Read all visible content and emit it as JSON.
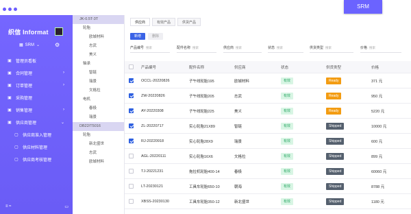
{
  "window": {
    "srm_tab_label": "SRM"
  },
  "sidebar": {
    "brand": "织信 Informat",
    "module_select": "SRM",
    "menu": [
      {
        "icon": "dashboard-icon",
        "label": "管理员看板",
        "arrow": ""
      },
      {
        "icon": "contract-icon",
        "label": "合同管理",
        "arrow": "›"
      },
      {
        "icon": "order-icon",
        "label": "订单管理",
        "arrow": "›"
      },
      {
        "icon": "purchase-icon",
        "label": "采购管理",
        "arrow": ""
      },
      {
        "icon": "sales-icon",
        "label": "销售管理",
        "arrow": "›"
      },
      {
        "icon": "supplier-icon",
        "label": "供应商管理",
        "arrow": "⌄"
      }
    ],
    "submenu": [
      {
        "icon": "entry-icon",
        "label": "供应商准入管理"
      },
      {
        "icon": "material-icon",
        "label": "供应材料管理"
      },
      {
        "icon": "assessment-icon",
        "label": "供应商考核管理"
      }
    ],
    "bottom_left": "≡  ≈",
    "bottom_right": "▭"
  },
  "tree": [
    {
      "type": "group",
      "label": "JK-0.5T-3T"
    },
    {
      "type": "l1",
      "label": "轮胎"
    },
    {
      "type": "l2",
      "label": "欧城材料"
    },
    {
      "type": "l2",
      "label": "志武"
    },
    {
      "type": "l2",
      "label": "美义"
    },
    {
      "type": "l1",
      "label": "轴承"
    },
    {
      "type": "l2",
      "label": "智链"
    },
    {
      "type": "l2",
      "label": "瑞景"
    },
    {
      "type": "l2",
      "label": "文格拉"
    },
    {
      "type": "l1",
      "label": "电机"
    },
    {
      "type": "l2",
      "label": "春极"
    },
    {
      "type": "l2",
      "label": "瑞景"
    },
    {
      "type": "group",
      "label": "DB22/T5016"
    },
    {
      "type": "l1",
      "label": "轮胎"
    },
    {
      "type": "l2",
      "label": "新北盛世"
    },
    {
      "type": "l2",
      "label": "志武"
    },
    {
      "type": "l2",
      "label": "欧城材料"
    }
  ],
  "main": {
    "tabs": [
      "供应商",
      "有效产品",
      "供货产品"
    ],
    "btn_new": "新增",
    "btn_delete": "删除",
    "filters": [
      {
        "label": "产品编号",
        "placeholder": "搜索"
      },
      {
        "label": "配件名称",
        "placeholder": "搜索"
      },
      {
        "label": "供应商",
        "placeholder": "搜索"
      },
      {
        "label": "状态",
        "placeholder": "搜索"
      },
      {
        "label": "供货类型",
        "placeholder": "搜索"
      },
      {
        "label": "价格",
        "placeholder": "搜索"
      }
    ],
    "columns": [
      "产品编号",
      "配件名称",
      "供应商",
      "状态",
      "供货类型",
      "价格"
    ],
    "rows": [
      {
        "checked": true,
        "code": "OCCL-20220826",
        "part": "子午线轮胎195",
        "supplier": "欧城材料",
        "status": "有效",
        "type": "Ready",
        "price": "371 元"
      },
      {
        "checked": true,
        "code": "ZW-20220826",
        "part": "子午线轮胎205",
        "supplier": "志武",
        "status": "有效",
        "type": "Ready",
        "price": "950 元"
      },
      {
        "checked": true,
        "code": "AY-20220308",
        "part": "子午线轮胎225",
        "supplier": "美义",
        "status": "有效",
        "type": "Ready",
        "price": "5220 元"
      },
      {
        "checked": true,
        "code": "ZL-20220717",
        "part": "实心轮胎21X89",
        "supplier": "智链",
        "status": "有效",
        "type": "Shipped",
        "price": "10000 元"
      },
      {
        "checked": true,
        "code": "RJ-20220918",
        "part": "实心轮胎28X9",
        "supplier": "瑞景",
        "status": "有效",
        "type": "Shipped",
        "price": "600 元"
      },
      {
        "checked": false,
        "code": "AGL-20220111",
        "part": "实心轮胎16X6",
        "supplier": "文格拉",
        "status": "有效",
        "type": "Shipped",
        "price": "899 元"
      },
      {
        "checked": false,
        "code": "TJ-20221231",
        "part": "拖拉机轮胎400-14",
        "supplier": "春极",
        "status": "有效",
        "type": "Shipped",
        "price": "60060 元"
      },
      {
        "checked": false,
        "code": "LT-20230121",
        "part": "工具车轮胎650-10",
        "supplier": "朝海",
        "status": "有效",
        "type": "Shipped",
        "price": "8788 元"
      },
      {
        "checked": false,
        "code": "XBSS-20230130",
        "part": "工具车轮胎350-12",
        "supplier": "新北盛世",
        "status": "有效",
        "type": "Shipped",
        "price": "1180 元"
      }
    ]
  },
  "colors": {
    "accent": "#6b63ff",
    "ready": "#f39c12",
    "shipped": "#55606e",
    "valid_bg": "#d8f5e4",
    "valid_text": "#2aa864"
  }
}
